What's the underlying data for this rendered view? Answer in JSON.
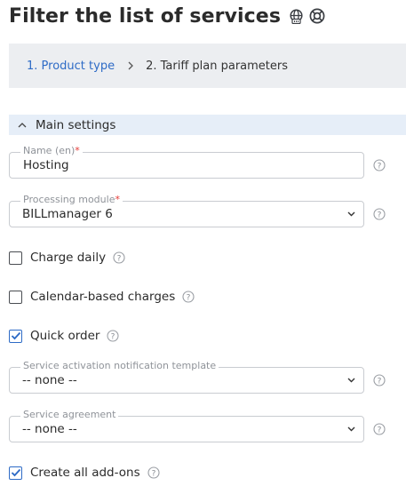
{
  "header": {
    "title": "Filter the list of services",
    "icons": [
      "globe-network-icon",
      "lifebuoy-help-icon"
    ]
  },
  "wizard": {
    "steps": [
      {
        "label": "1. Product type",
        "state": "link"
      },
      {
        "label": "2. Tariff plan parameters",
        "state": "current"
      }
    ],
    "separator_icon": "chevron-right-icon"
  },
  "section": {
    "label": "Main settings",
    "state": "expanded",
    "icon": "chevron-up-icon"
  },
  "form": {
    "name": {
      "label": "Name (en)",
      "required_mark": "*",
      "value": "Hosting"
    },
    "processing_module": {
      "label": "Processing module",
      "required_mark": "*",
      "value": "BILLmanager 6"
    },
    "charge_daily": {
      "label": "Charge daily",
      "checked": false
    },
    "calendar_charges": {
      "label": "Calendar-based charges",
      "checked": false
    },
    "quick_order": {
      "label": "Quick order",
      "checked": true
    },
    "notification_template": {
      "label": "Service activation notification template",
      "value": "-- none --"
    },
    "service_agreement": {
      "label": "Service agreement",
      "value": "-- none --"
    },
    "create_addons": {
      "label": "Create all add-ons",
      "checked": true
    }
  },
  "colors": {
    "accent": "#2e6bc6",
    "required": "#e53935",
    "steps_bg": "#eceef1",
    "section_bg": "#e6eef8",
    "border": "#c9ccd1"
  }
}
